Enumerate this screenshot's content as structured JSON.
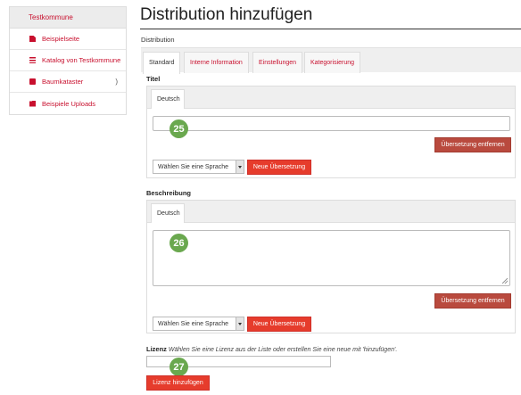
{
  "sidebar": {
    "header": "Testkommune",
    "items": [
      {
        "label": "Beispielseite",
        "icon": "document-icon"
      },
      {
        "label": "Katalog von Testkommune",
        "icon": "list-icon"
      },
      {
        "label": "Baumkataster",
        "icon": "briefcase-icon",
        "chevron": ")"
      },
      {
        "label": "Beispiele Uploads",
        "icon": "folder-icon"
      }
    ]
  },
  "page": {
    "title": "Distribution hinzufügen",
    "breadcrumb": "Distribution"
  },
  "tabs": [
    "Standard",
    "Interne Information",
    "Einstellungen",
    "Kategorisierung"
  ],
  "titel": {
    "label": "Titel",
    "lang_tab": "Deutsch",
    "value": "",
    "badge": "25",
    "remove_button": "Übersetzung entfernen",
    "select_value": "Wählen Sie eine Sprache",
    "add_button": "Neue Übersetzung"
  },
  "beschreibung": {
    "label": "Beschreibung",
    "lang_tab": "Deutsch",
    "value": "",
    "badge": "26",
    "remove_button": "Übersetzung entfernen",
    "select_value": "Wählen Sie eine Sprache",
    "add_button": "Neue Übersetzung"
  },
  "lizenz": {
    "label": "Lizenz",
    "hint": "Wählen Sie eine Lizenz aus der Liste oder erstellen Sie eine neue mit 'hinzufügen'.",
    "value": "",
    "badge": "27",
    "add_button": "Lizenz hinzufügen"
  },
  "colors": {
    "accent": "#c8102e",
    "button_red": "#e63c2c",
    "button_dark": "#b94a3e",
    "badge_green": "#6aa84f"
  }
}
